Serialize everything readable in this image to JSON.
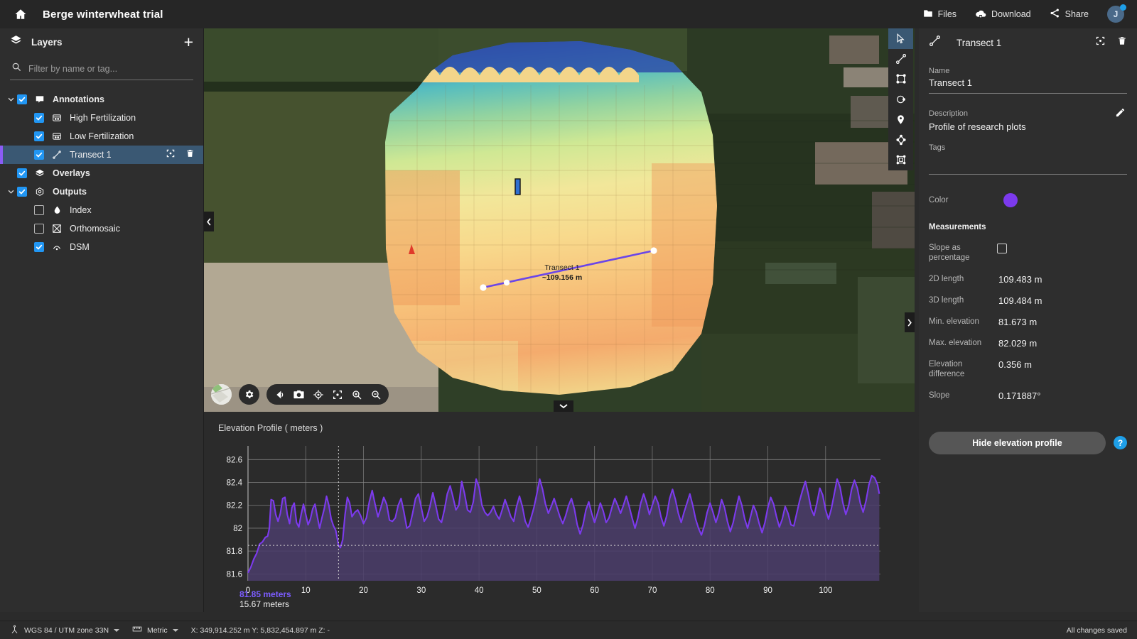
{
  "header": {
    "home_icon": "home-icon",
    "project_title": "Berge winterwheat trial",
    "files_label": "Files",
    "download_label": "Download",
    "share_label": "Share",
    "avatar_initial": "J"
  },
  "sidebar": {
    "title": "Layers",
    "add_label": "+",
    "search_placeholder": "Filter by name or tag...",
    "search_value": "",
    "items": [
      {
        "label": "Annotations",
        "icon": "annotation-icon",
        "checked": true,
        "indent": 0,
        "caret": true,
        "bold": true,
        "selected": false,
        "accent": "none"
      },
      {
        "label": "High Fertilization",
        "icon": "area-icon",
        "checked": true,
        "indent": 1,
        "caret": false,
        "bold": false,
        "selected": false,
        "accent": "blue"
      },
      {
        "label": "Low Fertilization",
        "icon": "area-icon",
        "checked": true,
        "indent": 1,
        "caret": false,
        "bold": false,
        "selected": false,
        "accent": "dark"
      },
      {
        "label": "Transect 1",
        "icon": "transect-icon",
        "checked": true,
        "indent": 1,
        "caret": false,
        "bold": false,
        "selected": true,
        "accent": "purple"
      },
      {
        "label": "Overlays",
        "icon": "layers-icon",
        "checked": true,
        "indent": 0,
        "caret": false,
        "bold": true,
        "selected": false,
        "accent": "none"
      },
      {
        "label": "Outputs",
        "icon": "outputs-icon",
        "checked": true,
        "indent": 0,
        "caret": true,
        "bold": true,
        "selected": false,
        "accent": "none"
      },
      {
        "label": "Index",
        "icon": "index-icon",
        "checked": false,
        "indent": 1,
        "caret": false,
        "bold": false,
        "selected": false,
        "accent": "none"
      },
      {
        "label": "Orthomosaic",
        "icon": "orthomosaic-icon",
        "checked": false,
        "indent": 1,
        "caret": false,
        "bold": false,
        "selected": false,
        "accent": "none"
      },
      {
        "label": "DSM",
        "icon": "dsm-icon",
        "checked": true,
        "indent": 1,
        "caret": false,
        "bold": false,
        "selected": false,
        "accent": "none"
      }
    ],
    "row_actions": {
      "focus": "focus-icon",
      "delete": "trash-icon"
    }
  },
  "map": {
    "transect_label": "Transect 1",
    "transect_length": "~109.156 m",
    "tools": [
      {
        "name": "select-tool",
        "active": true
      },
      {
        "name": "transect-tool",
        "active": false
      },
      {
        "name": "rectangle-tool",
        "active": false
      },
      {
        "name": "circle-tool",
        "active": false
      },
      {
        "name": "marker-tool",
        "active": false
      },
      {
        "name": "polygon-tool",
        "active": false
      },
      {
        "name": "volume-tool",
        "active": false
      }
    ],
    "bottom_tools": [
      "minimap",
      "settings-gear",
      "measure-angle",
      "camera-snapshot",
      "recenter-target",
      "fit-view",
      "zoom-in",
      "zoom-out"
    ]
  },
  "right_panel": {
    "title": "Transect 1",
    "header_icon": "transect-icon",
    "focus_icon": "focus-icon",
    "delete_icon": "trash-icon",
    "name_label": "Name",
    "name_value": "Transect 1",
    "description_label": "Description",
    "description_value": "Profile of research plots",
    "edit_icon": "pencil-icon",
    "tags_label": "Tags",
    "tags_value": "",
    "color_label": "Color",
    "color_value": "#7c3aed",
    "measurements_label": "Measurements",
    "measurements": [
      {
        "key": "Slope as percentage",
        "value": "",
        "type": "checkbox",
        "checked": false
      },
      {
        "key": "2D length",
        "value": "109.483 m",
        "type": "text"
      },
      {
        "key": "3D length",
        "value": "109.484 m",
        "type": "text"
      },
      {
        "key": "Min. elevation",
        "value": "81.673 m",
        "type": "text"
      },
      {
        "key": "Max. elevation",
        "value": "82.029 m",
        "type": "text"
      },
      {
        "key": "Elevation difference",
        "value": "0.356 m",
        "type": "text"
      },
      {
        "key": "Slope",
        "value": "0.171887°",
        "type": "text"
      }
    ],
    "hide_profile_label": "Hide elevation profile",
    "help_label": "?"
  },
  "side_tools": [
    {
      "name": "fit-profile-icon"
    },
    {
      "name": "export-profile-icon"
    }
  ],
  "readouts": {
    "elevation": "81.85 meters",
    "distance": "15.67 meters"
  },
  "status_bar": {
    "crs_icon": "crs-icon",
    "crs": "WGS 84 / UTM zone 33N",
    "units_icon": "ruler-icon",
    "units": "Metric",
    "coords": "X: 349,914.252 m  Y: 5,832,454.897 m  Z: -",
    "saved": "All changes saved"
  },
  "chart_data": {
    "type": "area",
    "title": "Elevation Profile ( meters )",
    "xlabel": "",
    "ylabel": "",
    "xlim": [
      0,
      109.5
    ],
    "ylim": [
      81.54,
      82.72
    ],
    "xticks": [
      0,
      10,
      20,
      30,
      40,
      50,
      60,
      70,
      80,
      90,
      100
    ],
    "yticks": [
      81.6,
      81.8,
      82,
      82.2,
      82.4,
      82.6
    ],
    "grid": true,
    "legend": false,
    "line_color": "#7c3aed",
    "fill_color": "#4b3d6b",
    "cursor_x": 15.67,
    "cursor_y": 81.85,
    "x": [
      0,
      0.5,
      1,
      1.5,
      2,
      2.5,
      3,
      3.4,
      3.7,
      4,
      4.4,
      4.8,
      5.2,
      5.6,
      6,
      6.4,
      6.8,
      7.2,
      7.6,
      8,
      8.4,
      8.8,
      9.2,
      9.6,
      10,
      10.4,
      10.8,
      11.2,
      11.6,
      12,
      12.4,
      12.8,
      13.2,
      13.6,
      14,
      14.4,
      14.8,
      15.2,
      15.67,
      16,
      16.4,
      16.8,
      17.2,
      17.6,
      18,
      18.5,
      19,
      19.5,
      20,
      20.5,
      21,
      21.5,
      22,
      22.5,
      23,
      23.5,
      24,
      24.5,
      25,
      25.5,
      26,
      26.5,
      27,
      27.5,
      28,
      28.5,
      29,
      29.5,
      30,
      30.5,
      31,
      31.5,
      32,
      32.5,
      33,
      33.5,
      34,
      34.5,
      35,
      35.5,
      36,
      36.5,
      37,
      37.5,
      38,
      38.5,
      39,
      39.5,
      40,
      40.5,
      41,
      41.5,
      42,
      42.5,
      43,
      43.5,
      44,
      44.5,
      45,
      45.5,
      46,
      46.5,
      47,
      47.5,
      48,
      48.5,
      49,
      49.5,
      50,
      50.5,
      51,
      51.5,
      52,
      52.5,
      53,
      53.5,
      54,
      54.5,
      55,
      55.5,
      56,
      56.5,
      57,
      57.5,
      58,
      58.5,
      59,
      59.5,
      60,
      60.5,
      61,
      61.5,
      62,
      62.5,
      63,
      63.5,
      64,
      64.5,
      65,
      65.5,
      66,
      66.5,
      67,
      67.5,
      68,
      68.5,
      69,
      69.5,
      70,
      70.5,
      71,
      71.5,
      72,
      72.5,
      73,
      73.5,
      74,
      74.5,
      75,
      75.5,
      76,
      76.5,
      77,
      77.5,
      78,
      78.5,
      79,
      79.5,
      80,
      80.5,
      81,
      81.5,
      82,
      82.5,
      83,
      83.5,
      84,
      84.5,
      85,
      85.5,
      86,
      86.5,
      87,
      87.5,
      88,
      88.5,
      89,
      89.5,
      90,
      90.5,
      91,
      91.5,
      92,
      92.5,
      93,
      93.5,
      94,
      94.5,
      95,
      95.5,
      96,
      96.5,
      97,
      97.5,
      98,
      98.5,
      99,
      99.5,
      100,
      100.5,
      101,
      101.5,
      102,
      102.5,
      103,
      103.5,
      104,
      104.5,
      105,
      105.5,
      106,
      106.5,
      107,
      107.5,
      108,
      108.5,
      109,
      109.3
    ],
    "y": [
      81.61,
      81.66,
      81.73,
      81.78,
      81.86,
      81.88,
      81.92,
      81.93,
      82.0,
      82.25,
      82.24,
      82.12,
      82.06,
      82.13,
      82.26,
      82.27,
      82.12,
      82.04,
      82.18,
      82.22,
      82.05,
      82.01,
      82.12,
      82.21,
      82.12,
      82.03,
      82.08,
      82.17,
      82.21,
      82.1,
      82.0,
      82.09,
      82.17,
      82.28,
      82.2,
      82.08,
      82.02,
      81.98,
      81.85,
      81.83,
      81.9,
      82.12,
      82.27,
      82.22,
      82.1,
      82.14,
      82.16,
      82.11,
      82.04,
      82.09,
      82.23,
      82.33,
      82.21,
      82.1,
      82.18,
      82.27,
      82.21,
      82.07,
      82.06,
      82.09,
      82.2,
      82.26,
      82.14,
      82.0,
      82.02,
      82.13,
      82.26,
      82.3,
      82.18,
      82.06,
      82.1,
      82.19,
      82.31,
      82.2,
      82.08,
      82.05,
      82.16,
      82.3,
      82.37,
      82.27,
      82.16,
      82.2,
      82.41,
      82.3,
      82.16,
      82.14,
      82.23,
      82.43,
      82.36,
      82.2,
      82.14,
      82.11,
      82.14,
      82.19,
      82.12,
      82.08,
      82.16,
      82.25,
      82.18,
      82.1,
      82.06,
      82.19,
      82.28,
      82.19,
      82.06,
      82.01,
      82.09,
      82.18,
      82.3,
      82.43,
      82.34,
      82.21,
      82.13,
      82.19,
      82.26,
      82.18,
      82.1,
      82.04,
      82.11,
      82.2,
      82.26,
      82.17,
      82.03,
      81.95,
      82.03,
      82.16,
      82.23,
      82.13,
      82.05,
      82.13,
      82.22,
      82.15,
      82.05,
      82.09,
      82.18,
      82.26,
      82.2,
      82.13,
      82.2,
      82.28,
      82.19,
      82.09,
      82.0,
      82.09,
      82.22,
      82.3,
      82.22,
      82.12,
      82.2,
      82.28,
      82.22,
      82.1,
      82.02,
      82.11,
      82.26,
      82.34,
      82.25,
      82.13,
      82.05,
      82.14,
      82.22,
      82.3,
      82.2,
      82.08,
      82.0,
      81.94,
      82.02,
      82.14,
      82.22,
      82.14,
      82.05,
      82.13,
      82.25,
      82.18,
      82.06,
      81.97,
      82.05,
      82.17,
      82.28,
      82.2,
      82.08,
      82.0,
      82.1,
      82.2,
      82.14,
      82.04,
      81.96,
      82.05,
      82.18,
      82.27,
      82.21,
      82.1,
      82.01,
      82.08,
      82.19,
      82.13,
      82.03,
      82.02,
      82.13,
      82.24,
      82.33,
      82.41,
      82.3,
      82.17,
      82.11,
      82.22,
      82.35,
      82.29,
      82.16,
      82.08,
      82.17,
      82.3,
      82.43,
      82.36,
      82.22,
      82.12,
      82.2,
      82.34,
      82.42,
      82.35,
      82.22,
      82.14,
      82.24,
      82.38,
      82.46,
      82.44,
      82.38,
      82.3,
      82.36,
      82.44,
      82.46,
      82.41,
      82.34,
      82.38,
      82.42,
      82.4,
      82.38,
      82.36,
      82.3,
      82.1,
      81.99,
      81.96,
      82.02,
      82.0,
      82.01,
      82.03
    ]
  }
}
